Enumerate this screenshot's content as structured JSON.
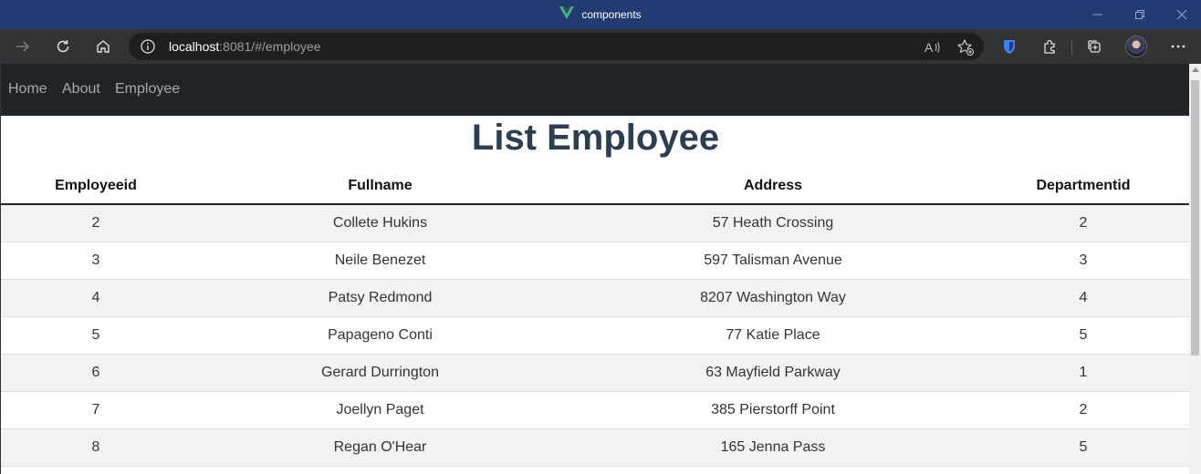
{
  "window": {
    "title": "components",
    "accent_color": "#243a73"
  },
  "browser": {
    "url_host": "localhost",
    "url_rest": ":8081/#/employee"
  },
  "nav": {
    "items": [
      {
        "label": "Home"
      },
      {
        "label": "About"
      },
      {
        "label": "Employee"
      }
    ]
  },
  "page": {
    "title": "List Employee"
  },
  "table": {
    "headers": [
      "Employeeid",
      "Fullname",
      "Address",
      "Departmentid"
    ],
    "rows": [
      [
        "2",
        "Collete Hukins",
        "57 Heath Crossing",
        "2"
      ],
      [
        "3",
        "Neile Benezet",
        "597 Talisman Avenue",
        "3"
      ],
      [
        "4",
        "Patsy Redmond",
        "8207 Washington Way",
        "4"
      ],
      [
        "5",
        "Papageno Conti",
        "77 Katie Place",
        "5"
      ],
      [
        "6",
        "Gerard Durrington",
        "63 Mayfield Parkway",
        "1"
      ],
      [
        "7",
        "Joellyn Paget",
        "385 Pierstorff Point",
        "2"
      ],
      [
        "8",
        "Regan O'Hear",
        "165 Jenna Pass",
        "5"
      ]
    ]
  }
}
